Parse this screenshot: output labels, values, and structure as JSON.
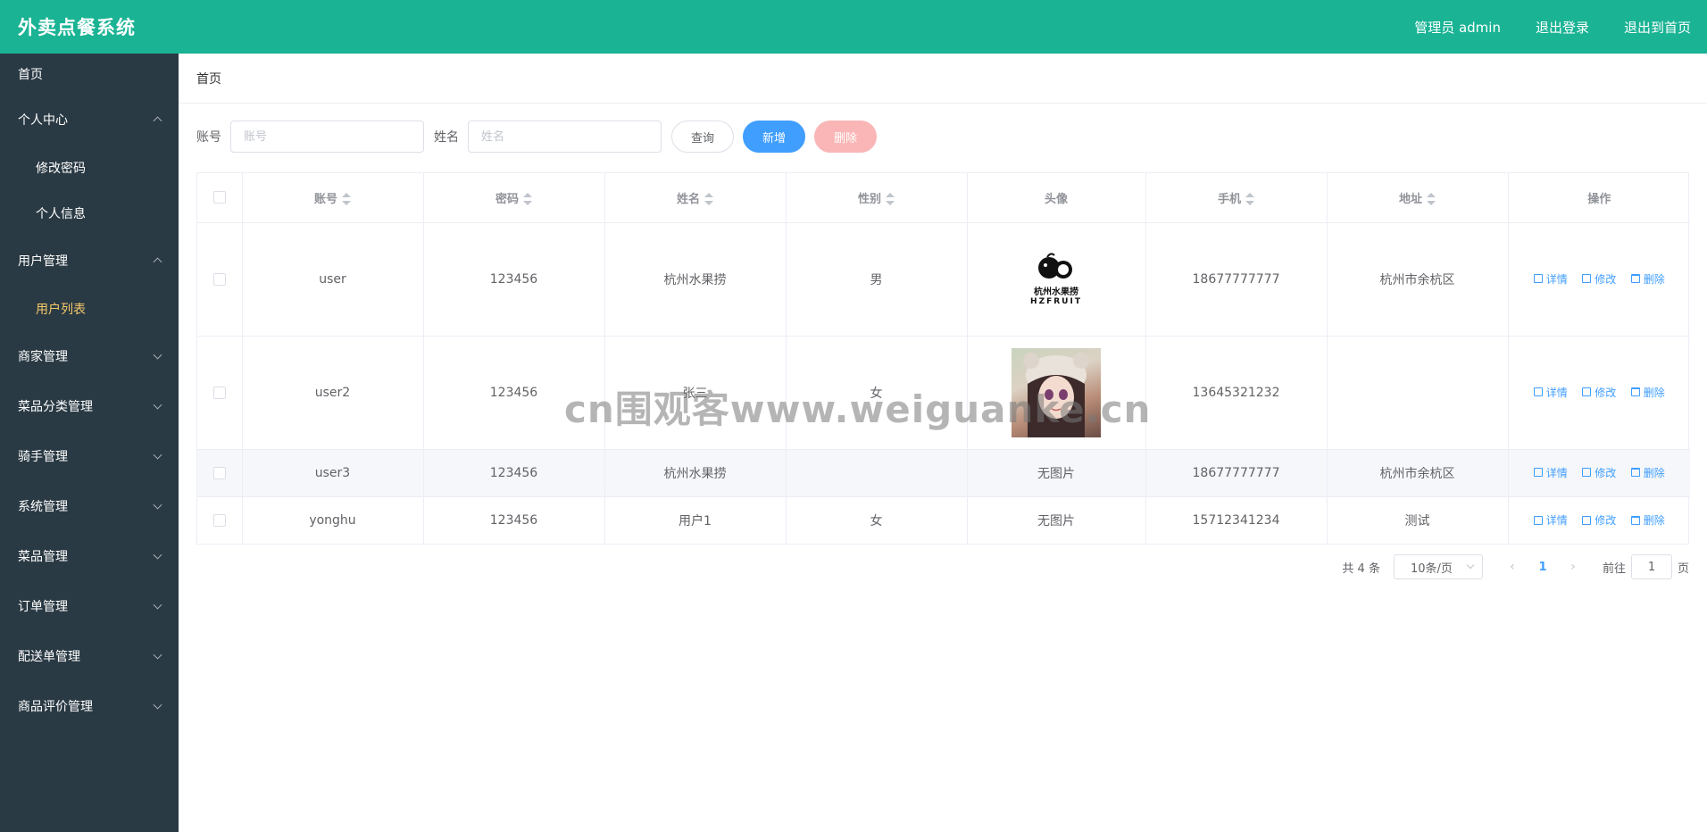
{
  "header": {
    "app_title": "外卖点餐系统",
    "user_label": "管理员 admin",
    "logout_label": "退出登录",
    "home_label": "退出到首页"
  },
  "sidebar": {
    "home": "首页",
    "personal_center": "个人中心",
    "change_password": "修改密码",
    "personal_info": "个人信息",
    "user_mgmt": "用户管理",
    "user_list": "用户列表",
    "merchant_mgmt": "商家管理",
    "dish_category_mgmt": "菜品分类管理",
    "rider_mgmt": "骑手管理",
    "system_mgmt": "系统管理",
    "dish_mgmt": "菜品管理",
    "order_mgmt": "订单管理",
    "delivery_mgmt": "配送单管理",
    "review_mgmt": "商品评价管理"
  },
  "breadcrumb": {
    "home": "首页"
  },
  "search": {
    "account_label": "账号",
    "account_placeholder": "账号",
    "name_label": "姓名",
    "name_placeholder": "姓名",
    "query_btn": "查询",
    "add_btn": "新增",
    "delete_btn": "删除"
  },
  "table": {
    "headers": {
      "account": "账号",
      "password": "密码",
      "name": "姓名",
      "gender": "性别",
      "avatar": "头像",
      "phone": "手机",
      "address": "地址",
      "actions": "操作"
    },
    "rows": [
      {
        "account": "user",
        "password": "123456",
        "name": "杭州水果捞",
        "gender": "男",
        "avatar_type": "logo",
        "avatar_text_1": "杭州水果捞",
        "avatar_text_2": "HZFRUIT",
        "phone": "18677777777",
        "address": "杭州市余杭区"
      },
      {
        "account": "user2",
        "password": "123456",
        "name": "张三",
        "gender": "女",
        "avatar_type": "photo",
        "phone": "13645321232",
        "address": ""
      },
      {
        "account": "user3",
        "password": "123456",
        "name": "杭州水果捞",
        "gender": "",
        "avatar_type": "none",
        "avatar_text": "无图片",
        "phone": "18677777777",
        "address": "杭州市余杭区"
      },
      {
        "account": "yonghu",
        "password": "123456",
        "name": "用户1",
        "gender": "女",
        "avatar_type": "none",
        "avatar_text": "无图片",
        "phone": "15712341234",
        "address": "测试"
      }
    ],
    "actions": {
      "detail": "详情",
      "edit": "修改",
      "delete": "删除"
    }
  },
  "pagination": {
    "total": "共 4 条",
    "page_size": "10条/页",
    "current_page": "1",
    "goto_label": "前往",
    "goto_value": "1",
    "page_suffix": "页"
  },
  "watermark": "cn围观客www.weiguanke.cn",
  "colors": {
    "header_bg": "#1ab394",
    "sidebar_bg": "#2a3a44",
    "active_menu": "#f6ca6a",
    "primary": "#409eff",
    "danger_light": "#fab6b6"
  }
}
